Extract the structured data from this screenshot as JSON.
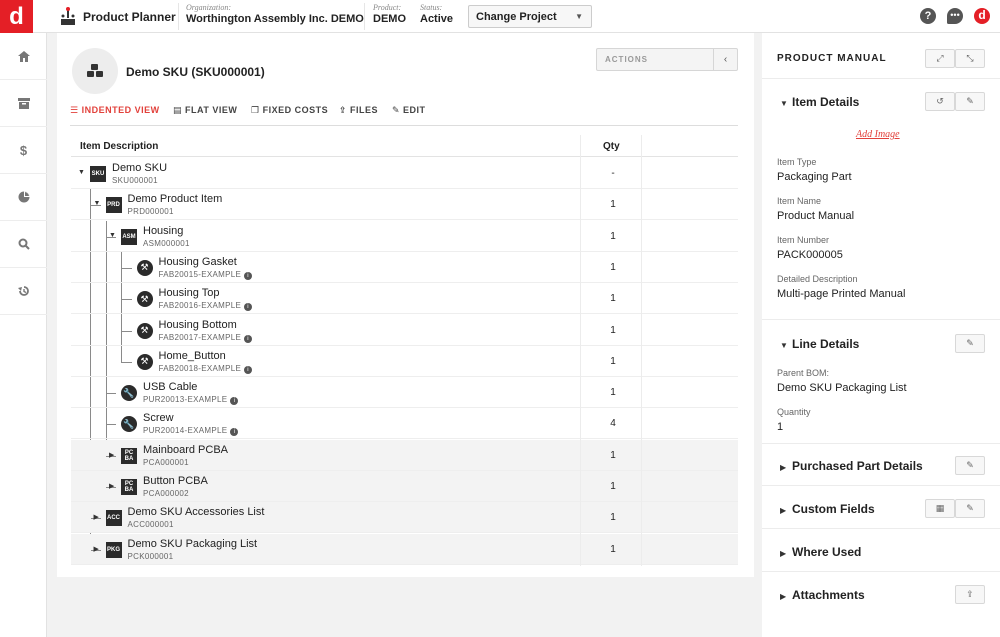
{
  "header": {
    "app_title": "Product Planner",
    "organization_label": "Organization:",
    "organization_value": "Worthington Assembly Inc. DEMO",
    "product_label": "Product:",
    "product_value": "DEMO",
    "status_label": "Status:",
    "status_value": "Active",
    "change_project_label": "Change Project",
    "logo_letter": "d",
    "user_initial": "d"
  },
  "rail": {
    "items": [
      "home-icon",
      "archive-icon",
      "dollar-icon",
      "pie-chart-icon",
      "search-icon",
      "history-icon"
    ]
  },
  "main": {
    "sku_title": "Demo SKU (SKU000001)",
    "actions_label": "ACTIONS",
    "tabs": [
      {
        "label": "INDENTED VIEW",
        "icon": "list-icon",
        "active": true
      },
      {
        "label": "FLAT VIEW",
        "icon": "table-icon",
        "active": false
      },
      {
        "label": "FIXED COSTS",
        "icon": "copy-icon",
        "active": false
      },
      {
        "label": "FILES",
        "icon": "upload-icon",
        "active": false
      },
      {
        "label": "EDIT",
        "icon": "pencil-icon",
        "active": false
      }
    ],
    "columns": {
      "desc": "Item Description",
      "qty": "Qty"
    },
    "rows": [
      {
        "name": "Demo SKU",
        "code": "SKU000001",
        "qty": "-",
        "badge": "SKU",
        "toggle": "open"
      },
      {
        "name": "Demo Product Item",
        "code": "PRD000001",
        "qty": "1",
        "badge": "PRD",
        "toggle": "open"
      },
      {
        "name": "Housing",
        "code": "ASM000001",
        "qty": "1",
        "badge": "ASM",
        "toggle": "open"
      },
      {
        "name": "Housing Gasket",
        "code": "FAB20015-EXAMPLE",
        "qty": "1",
        "badge": "hammer",
        "toggle": "none"
      },
      {
        "name": "Housing Top",
        "code": "FAB20016-EXAMPLE",
        "qty": "1",
        "badge": "hammer",
        "toggle": "none"
      },
      {
        "name": "Housing Bottom",
        "code": "FAB20017-EXAMPLE",
        "qty": "1",
        "badge": "hammer",
        "toggle": "none"
      },
      {
        "name": "Home_Button",
        "code": "FAB20018-EXAMPLE",
        "qty": "1",
        "badge": "hammer",
        "toggle": "none"
      },
      {
        "name": "USB Cable",
        "code": "PUR20013-EXAMPLE",
        "qty": "1",
        "badge": "wrench",
        "toggle": "none"
      },
      {
        "name": "Screw",
        "code": "PUR20014-EXAMPLE",
        "qty": "4",
        "badge": "wrench",
        "toggle": "none"
      },
      {
        "name": "Mainboard PCBA",
        "code": "PCA000001",
        "qty": "1",
        "badge": "PC BA",
        "toggle": "closed"
      },
      {
        "name": "Button PCBA",
        "code": "PCA000002",
        "qty": "1",
        "badge": "PC BA",
        "toggle": "closed"
      },
      {
        "name": "Demo SKU Accessories List",
        "code": "ACC000001",
        "qty": "1",
        "badge": "ACC",
        "toggle": "closed"
      },
      {
        "name": "Demo SKU Packaging List",
        "code": "PCK000001",
        "qty": "1",
        "badge": "PKG",
        "toggle": "closed"
      }
    ]
  },
  "right": {
    "title": "PRODUCT MANUAL",
    "item_details": {
      "title": "Item Details",
      "add_image": "Add Image",
      "fields": [
        {
          "label": "Item Type",
          "value": "Packaging Part"
        },
        {
          "label": "Item Name",
          "value": "Product Manual"
        },
        {
          "label": "Item Number",
          "value": "PACK000005"
        },
        {
          "label": "Detailed Description",
          "value": "Multi-page Printed Manual"
        }
      ]
    },
    "line_details": {
      "title": "Line Details",
      "fields": [
        {
          "label": "Parent BOM:",
          "value": "Demo SKU Packaging List"
        },
        {
          "label": "Quantity",
          "value": "1"
        }
      ]
    },
    "sections": {
      "purchased": "Purchased Part Details",
      "custom": "Custom Fields",
      "where_used": "Where Used",
      "attachments": "Attachments"
    }
  },
  "colors": {
    "brand": "#e41f26",
    "accent": "#e2413b",
    "dark": "#2b2b2b"
  }
}
